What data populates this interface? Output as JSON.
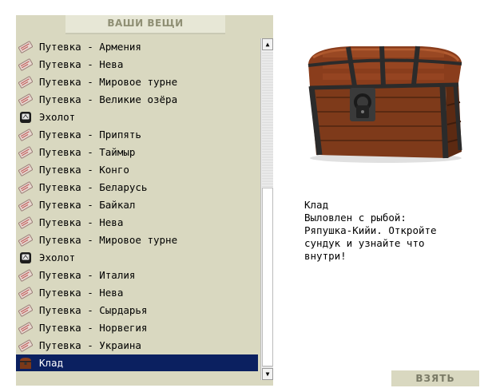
{
  "panel": {
    "title": "ВАШИ ВЕЩИ"
  },
  "items": [
    {
      "label": "Путевка - Армения",
      "icon": "voucher-icon"
    },
    {
      "label": "Путевка - Нева",
      "icon": "voucher-icon"
    },
    {
      "label": "Путевка - Мировое турне",
      "icon": "voucher-icon"
    },
    {
      "label": "Путевка - Великие озёра",
      "icon": "voucher-icon"
    },
    {
      "label": "Эхолот",
      "icon": "echo-sounder-icon"
    },
    {
      "label": "Путевка - Припять",
      "icon": "voucher-icon"
    },
    {
      "label": "Путевка - Таймыр",
      "icon": "voucher-icon"
    },
    {
      "label": "Путевка - Конго",
      "icon": "voucher-icon"
    },
    {
      "label": "Путевка - Беларусь",
      "icon": "voucher-icon"
    },
    {
      "label": "Путевка - Байкал",
      "icon": "voucher-icon"
    },
    {
      "label": "Путевка - Нева",
      "icon": "voucher-icon"
    },
    {
      "label": "Путевка - Мировое турне",
      "icon": "voucher-icon"
    },
    {
      "label": "Эхолот",
      "icon": "echo-sounder-icon"
    },
    {
      "label": "Путевка - Италия",
      "icon": "voucher-icon"
    },
    {
      "label": "Путевка - Нева",
      "icon": "voucher-icon"
    },
    {
      "label": "Путевка - Сырдарья",
      "icon": "voucher-icon"
    },
    {
      "label": "Путевка - Норвегия",
      "icon": "voucher-icon"
    },
    {
      "label": "Путевка - Украина",
      "icon": "voucher-icon"
    },
    {
      "label": "Клад",
      "icon": "chest-icon",
      "selected": true
    }
  ],
  "detail": {
    "image": "treasure-chest",
    "lines": [
      "Клад",
      "Выловлен с рыбой:",
      "Ряпушка-Кийи. Откройте",
      "сундук и узнайте что",
      "внутри!"
    ]
  },
  "actions": {
    "take_label": "ВЗЯТЬ"
  },
  "colors": {
    "panel_bg": "#d9d8c0",
    "header_bg": "#e7e7d6",
    "selection_bg": "#0b2060",
    "button_text": "#7a7a66"
  }
}
